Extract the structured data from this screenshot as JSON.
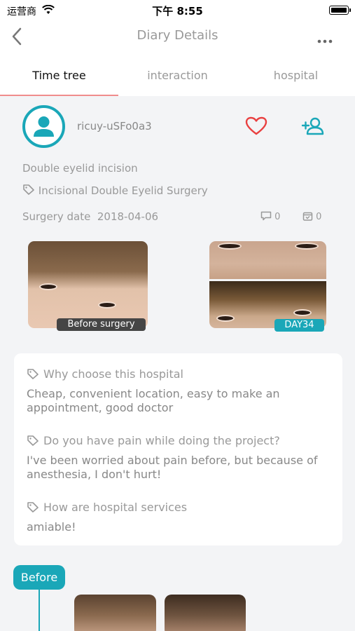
{
  "status_bar": {
    "carrier": "运营商",
    "time": "下午 8:55"
  },
  "nav": {
    "title": "Diary Details"
  },
  "tabs": [
    {
      "label": "Time tree",
      "active": true
    },
    {
      "label": "interaction",
      "active": false
    },
    {
      "label": "hospital",
      "active": false
    }
  ],
  "user": {
    "name": "ricuy-uSFo0a3"
  },
  "diary": {
    "project": "Double eyelid incision",
    "tag": "Incisional Double Eyelid Surgery",
    "surgery_date_label": "Surgery date",
    "surgery_date": "2018-04-06",
    "comment_count": "0",
    "calendar_count": "0"
  },
  "photos": {
    "before_label": "Before surgery",
    "after_label": "DAY34"
  },
  "qa": [
    {
      "question": "Why choose this hospital",
      "answer": "Cheap, convenient location, easy to make an appointment, good doctor"
    },
    {
      "question": "Do you have pain while doing the project?",
      "answer": "I've been worried about pain before, but because of anesthesia, I don't hurt!"
    },
    {
      "question": "How are hospital services",
      "answer": "amiable!"
    }
  ],
  "timeline": {
    "stage_label": "Before"
  },
  "colors": {
    "accent": "#1aa7b8",
    "heart": "#e94040",
    "tab_underline": "#f08c8c"
  }
}
